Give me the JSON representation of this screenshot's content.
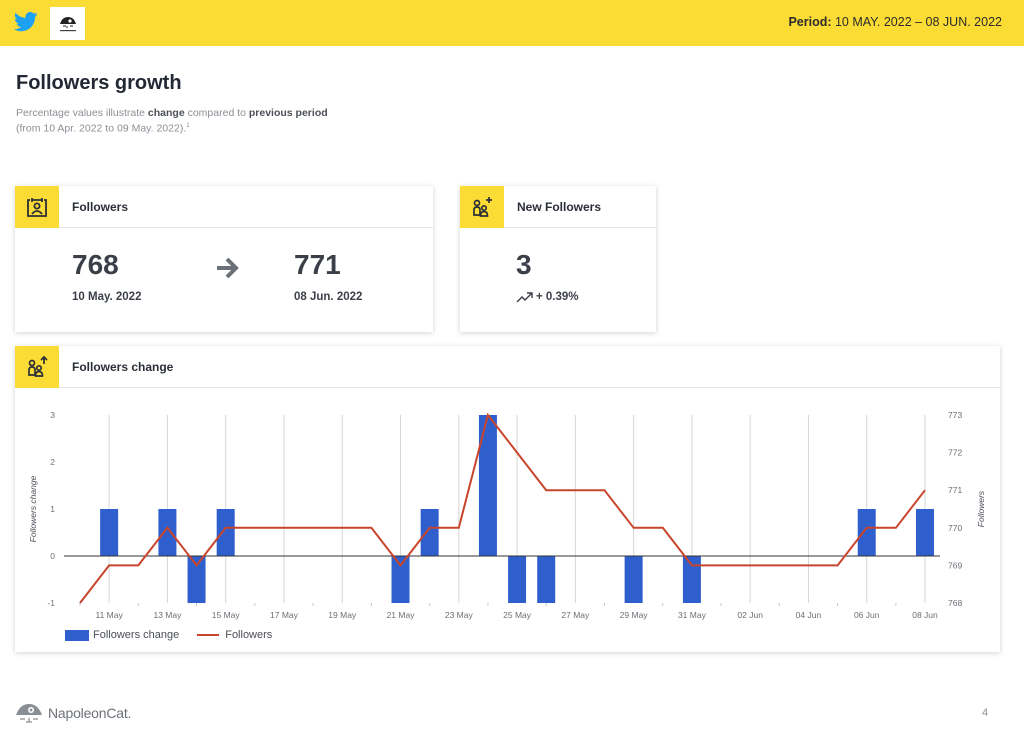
{
  "header": {
    "period_label": "Period:",
    "period_value": "10 MAY. 2022 – 08 JUN. 2022",
    "network_icon": "twitter-icon",
    "brand_logo": "napoleoncat-logo"
  },
  "page": {
    "title": "Followers growth",
    "subtitle_parts": {
      "p1": "Percentage values illustrate ",
      "b1": "change",
      "p2": " compared to ",
      "b2": "previous period",
      "p3": "(from 10 Apr. 2022 to 09 May. 2022).",
      "footnote": "1"
    }
  },
  "cards": {
    "followers": {
      "title": "Followers",
      "icon": "followers-calendar-icon",
      "start_value": "768",
      "start_date": "10 May. 2022",
      "end_value": "771",
      "end_date": "08 Jun. 2022"
    },
    "new_followers": {
      "title": "New Followers",
      "icon": "add-users-icon",
      "value": "3",
      "change": "+ 0.39%",
      "trend": "trending-up-icon"
    },
    "followers_change": {
      "title": "Followers change",
      "icon": "users-arrow-up-icon"
    }
  },
  "chart_data": {
    "type": "bar",
    "title": "Followers change",
    "x": [
      "10 May",
      "11 May",
      "12 May",
      "13 May",
      "14 May",
      "15 May",
      "16 May",
      "17 May",
      "18 May",
      "19 May",
      "20 May",
      "21 May",
      "22 May",
      "23 May",
      "24 May",
      "25 May",
      "26 May",
      "27 May",
      "28 May",
      "29 May",
      "30 May",
      "31 May",
      "01 Jun",
      "02 Jun",
      "03 Jun",
      "04 Jun",
      "05 Jun",
      "06 Jun",
      "07 Jun",
      "08 Jun"
    ],
    "x_tick_labels": [
      "11 May",
      "13 May",
      "15 May",
      "17 May",
      "19 May",
      "21 May",
      "23 May",
      "25 May",
      "27 May",
      "29 May",
      "31 May",
      "02 Jun",
      "04 Jun",
      "06 Jun",
      "08 Jun"
    ],
    "series": [
      {
        "name": "Followers change",
        "type": "bar",
        "axis": "left",
        "color": "#2f5fcc",
        "values": [
          0,
          1,
          0,
          1,
          -1,
          1,
          0,
          0,
          0,
          0,
          0,
          -1,
          1,
          0,
          3,
          -1,
          -1,
          0,
          0,
          -1,
          0,
          -1,
          0,
          0,
          0,
          0,
          0,
          1,
          0,
          1
        ]
      },
      {
        "name": "Followers",
        "type": "line",
        "axis": "right",
        "color": "#c8452c",
        "values": [
          768,
          769,
          769,
          770,
          769,
          770,
          770,
          770,
          770,
          770,
          770,
          769,
          770,
          770,
          773,
          772,
          771,
          771,
          771,
          770,
          770,
          769,
          769,
          769,
          769,
          769,
          769,
          770,
          770,
          771
        ]
      }
    ],
    "ylabel": "Followers change",
    "ylim": [
      -1,
      3
    ],
    "yticks": [
      -1,
      0,
      1,
      2,
      3
    ],
    "y2label": "Followers",
    "y2lim": [
      768,
      773
    ],
    "y2ticks": [
      768,
      769,
      770,
      771,
      772,
      773
    ],
    "grid": "vertical",
    "legend": "bottom-left"
  },
  "footer": {
    "brand": "NapoleonCat.",
    "page_number": "4"
  }
}
